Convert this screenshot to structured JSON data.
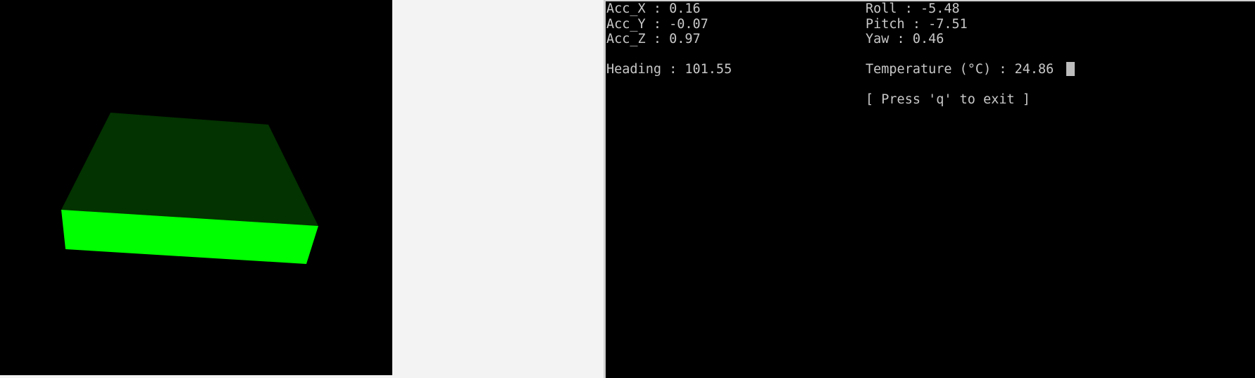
{
  "viewer": {
    "colors": {
      "background": "#000000",
      "top_face": "#033300",
      "front_face": "#00ff00"
    }
  },
  "terminal": {
    "acc_x": "Acc_X : 0.16",
    "acc_y": "Acc_Y : -0.07",
    "acc_z": "Acc_Z : 0.97",
    "heading": "Heading : 101.55",
    "roll": "Roll : -5.48",
    "pitch": "Pitch : -7.51",
    "yaw": "Yaw : 0.46",
    "temperature": "Temperature (°C) : 24.86",
    "exit_hint": "[ Press 'q' to exit ]",
    "colors": {
      "background": "#000000",
      "text": "#c8c8c8",
      "cursor": "#bdbdbd"
    }
  }
}
